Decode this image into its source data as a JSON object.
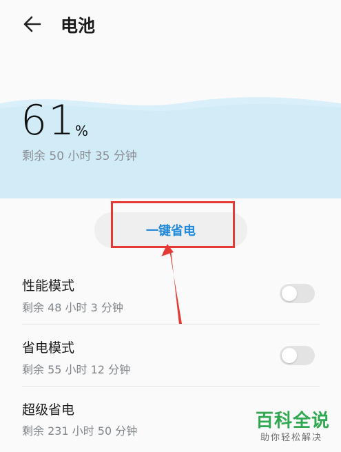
{
  "header": {
    "title": "电池",
    "back_icon": "arrow-left-icon"
  },
  "battery": {
    "percent": "61",
    "percent_sign": "%",
    "remaining": "剩余 50 小时 35 分钟",
    "wave_color": "#d6eef8"
  },
  "power_save_button": {
    "label": "一键省电",
    "color": "#1f88d8"
  },
  "modes": [
    {
      "label": "性能模式",
      "sub": "剩余 48 小时 3 分钟",
      "enabled": false
    },
    {
      "label": "省电模式",
      "sub": "剩余 55 小时 12 分钟",
      "enabled": false
    },
    {
      "label": "超级省电",
      "sub": "剩余 231 小时 50 分钟"
    }
  ],
  "annotation": {
    "highlight_color": "#e53935"
  },
  "watermark": {
    "title": "百科全说",
    "subtitle": "助你轻松解决"
  }
}
